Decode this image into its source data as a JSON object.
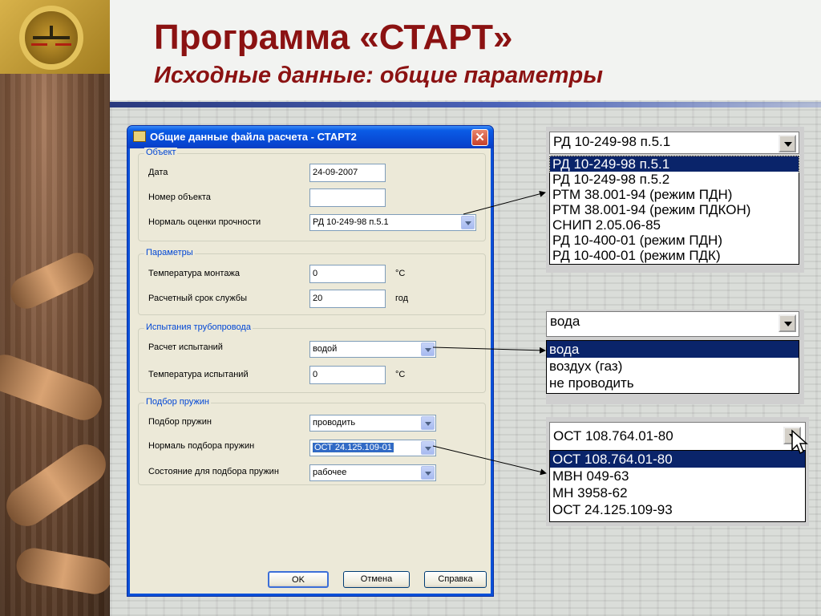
{
  "slide": {
    "title": "Программа «СТАРТ»",
    "subtitle": "Исходные данные: общие параметры"
  },
  "dialog": {
    "title": "Общие данные файла расчета - СТАРТ2",
    "groups": {
      "object": {
        "legend": "Объект",
        "date_label": "Дата",
        "date_value": "24-09-2007",
        "number_label": "Номер объекта",
        "number_value": "",
        "norm_label": "Нормаль оценки прочности",
        "norm_value": "РД 10-249-98 п.5.1"
      },
      "params": {
        "legend": "Параметры",
        "temp_label": "Температура монтажа",
        "temp_value": "0",
        "temp_unit": "°С",
        "life_label": "Расчетный срок службы",
        "life_value": "20",
        "life_unit": "год"
      },
      "tests": {
        "legend": "Испытания трубопровода",
        "calc_label": "Расчет испытаний",
        "calc_value": "водой",
        "temp_label": "Температура испытаний",
        "temp_value": "0",
        "temp_unit": "°С"
      },
      "springs": {
        "legend": "Подбор пружин",
        "select_label": "Подбор пружин",
        "select_value": "проводить",
        "norm_label": "Нормаль подбора пружин",
        "norm_value": "ОСТ 24.125.109-01",
        "state_label": "Состояние для подбора пружин",
        "state_value": "рабочее"
      }
    },
    "buttons": {
      "ok": "OK",
      "cancel": "Отмена",
      "help": "Справка"
    }
  },
  "popups": {
    "strength_norm": {
      "current": "РД 10-249-98 п.5.1",
      "options": [
        "РД 10-249-98 п.5.1",
        "РД 10-249-98 п.5.2",
        "РТМ 38.001-94 (режим ПДН)",
        "РТМ 38.001-94 (режим ПДКОН)",
        "СНИП 2.05.06-85",
        "РД 10-400-01 (режим ПДН)",
        "РД 10-400-01 (режим ПДК)"
      ]
    },
    "test_medium": {
      "current": "вода",
      "options": [
        "вода",
        "воздух (газ)",
        "не проводить"
      ]
    },
    "spring_norm": {
      "current": "ОСТ 108.764.01-80",
      "options": [
        "ОСТ 108.764.01-80",
        "МВН 049-63",
        "МН 3958-62",
        "ОСТ 24.125.109-93"
      ]
    }
  },
  "colors": {
    "title": "#8b1212",
    "xp_titlebar": "#0a50d8",
    "selection": "#0a246a",
    "group_legend": "#0046d5"
  }
}
